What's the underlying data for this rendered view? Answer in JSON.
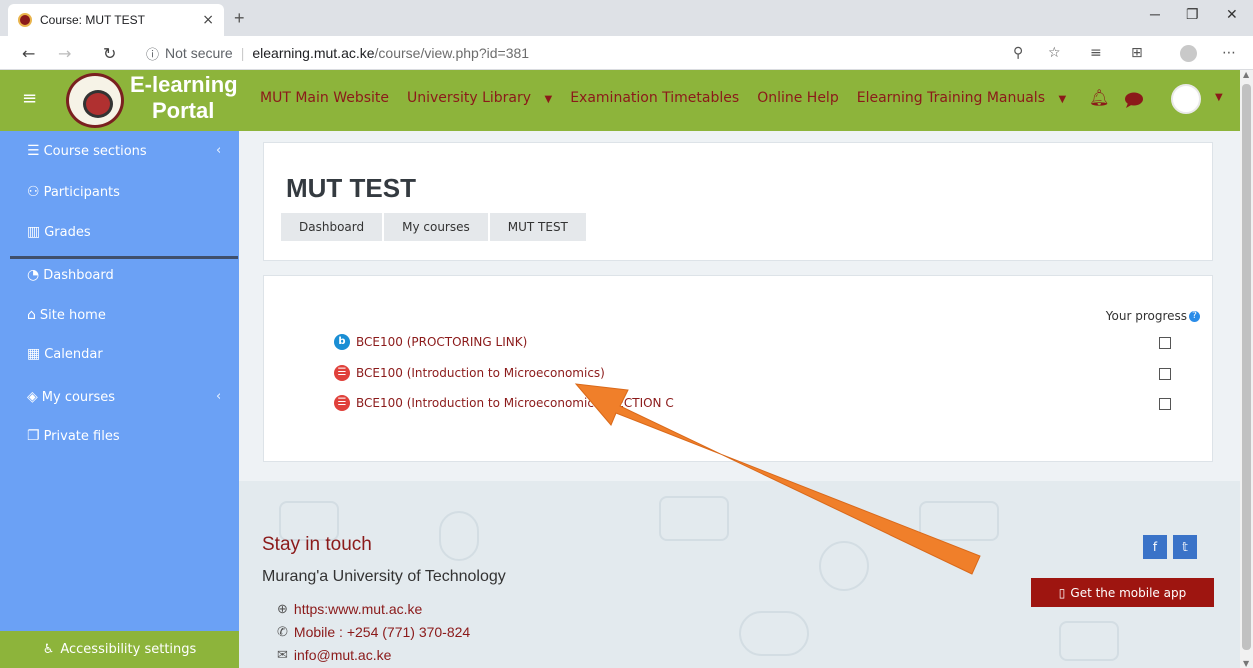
{
  "browser": {
    "tab_title": "Course: MUT TEST",
    "tab_close": "×",
    "new_tab": "+",
    "not_secure": "Not secure",
    "url_host": "elearning.mut.ac.ke",
    "url_path": "/course/view.php?id=381"
  },
  "navbar": {
    "brand_line1": "E-learning",
    "brand_line2": "Portal",
    "links": [
      {
        "label": "MUT Main Website",
        "caret": false
      },
      {
        "label": "University Library",
        "caret": true
      },
      {
        "label": "Examination Timetables",
        "caret": false
      },
      {
        "label": "Online Help",
        "caret": false
      },
      {
        "label": "Elearning Training Manuals",
        "caret": true
      }
    ],
    "icons": [
      "bell-icon",
      "chat-bubble-icon",
      "user-avatar-icon"
    ]
  },
  "sidebar": {
    "items": [
      {
        "label": "Course sections",
        "icon": "list-icon",
        "chevron": true
      },
      {
        "label": "Participants",
        "icon": "users-icon",
        "chevron": false
      },
      {
        "label": "Grades",
        "icon": "book-icon",
        "chevron": false
      },
      {
        "label": "Dashboard",
        "icon": "gauge-icon",
        "chevron": false
      },
      {
        "label": "Site home",
        "icon": "home-icon",
        "chevron": false
      },
      {
        "label": "Calendar",
        "icon": "calendar-icon",
        "chevron": false
      },
      {
        "label": "My courses",
        "icon": "graduation-cap-icon",
        "chevron": true
      },
      {
        "label": "Private files",
        "icon": "files-icon",
        "chevron": false
      }
    ],
    "accessibility": "Accessibility settings"
  },
  "header": {
    "course_title": "MUT TEST",
    "breadcrumbs": [
      "Dashboard",
      "My courses",
      "MUT TEST"
    ]
  },
  "activities": {
    "progress_label": "Your progress",
    "items": [
      {
        "icon": "bigbluebutton-icon",
        "label": "BCE100 (PROCTORING LINK)",
        "completed": false
      },
      {
        "icon": "quiz-icon",
        "label": "BCE100 (Introduction to Microeconomics)",
        "completed": false
      },
      {
        "icon": "quiz-icon",
        "label": "BCE100 (Introduction to Microeconomics) SECTION C",
        "completed": false
      }
    ]
  },
  "footer": {
    "stay_in_touch": "Stay in touch",
    "university": "Murang'a University of Technology",
    "website": "https:www.mut.ac.ke",
    "mobile": "Mobile : +254 (771) 370-824",
    "email": "info@mut.ac.ke",
    "mobile_app": "Get the mobile app"
  },
  "colors": {
    "navbar_green": "#8db43b",
    "sidebar_blue": "#6ba1f5",
    "link_maroon": "#8b1a1a",
    "annotation_arrow": "#f07f2a"
  }
}
